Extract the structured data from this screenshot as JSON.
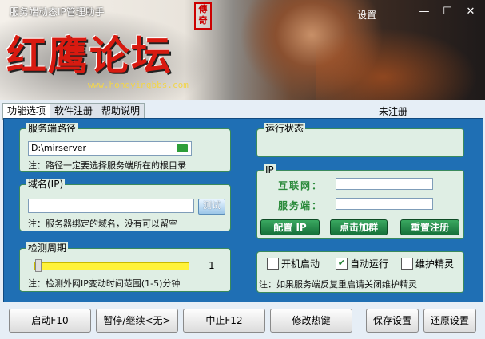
{
  "window": {
    "title": "服务端动态IP管理助手",
    "settings_label": "设置",
    "controls": {
      "min": "—",
      "max": "☐",
      "close": "✕"
    }
  },
  "banner": {
    "seal": "傳奇",
    "brand": "红鹰论坛",
    "url": "www.hongyingbbs.com"
  },
  "tabs": [
    {
      "label": "功能选项"
    },
    {
      "label": "软件注册"
    },
    {
      "label": "帮助说明"
    }
  ],
  "status_unregistered": "未注册",
  "server_path": {
    "group": "服务端路径",
    "value": "D:\\mirserver",
    "note": "注：路径一定要选择服务端所在的根目录"
  },
  "domain": {
    "group": "域名(IP)",
    "value": "",
    "test_label": "测试",
    "note": "注：服务器绑定的域名，没有可以留空"
  },
  "check_period": {
    "group": "检测周期",
    "value": "1",
    "note": "注：检测外网IP变动时间范围(1-5)分钟"
  },
  "run_status": {
    "group": "运行状态"
  },
  "ip": {
    "group": "IP",
    "internet_label": "互联网：",
    "server_label": "服务端：",
    "internet_value": "",
    "server_value": "",
    "config_btn": "配置 IP",
    "join_btn": "点击加群",
    "reregister_btn": "重置注册"
  },
  "options": {
    "autostart": "开机启动",
    "autorun": "自动运行",
    "guard": "维护精灵",
    "autostart_checked": false,
    "autorun_checked": true,
    "guard_checked": false,
    "note": "注：如果服务端反复重启请关闭维护精灵"
  },
  "bottom_buttons": {
    "start": "启动F10",
    "pause": "暂停/继续<无>",
    "stop": "中止F12",
    "hotkey": "修改热键",
    "save": "保存设置",
    "restore": "还原设置"
  }
}
